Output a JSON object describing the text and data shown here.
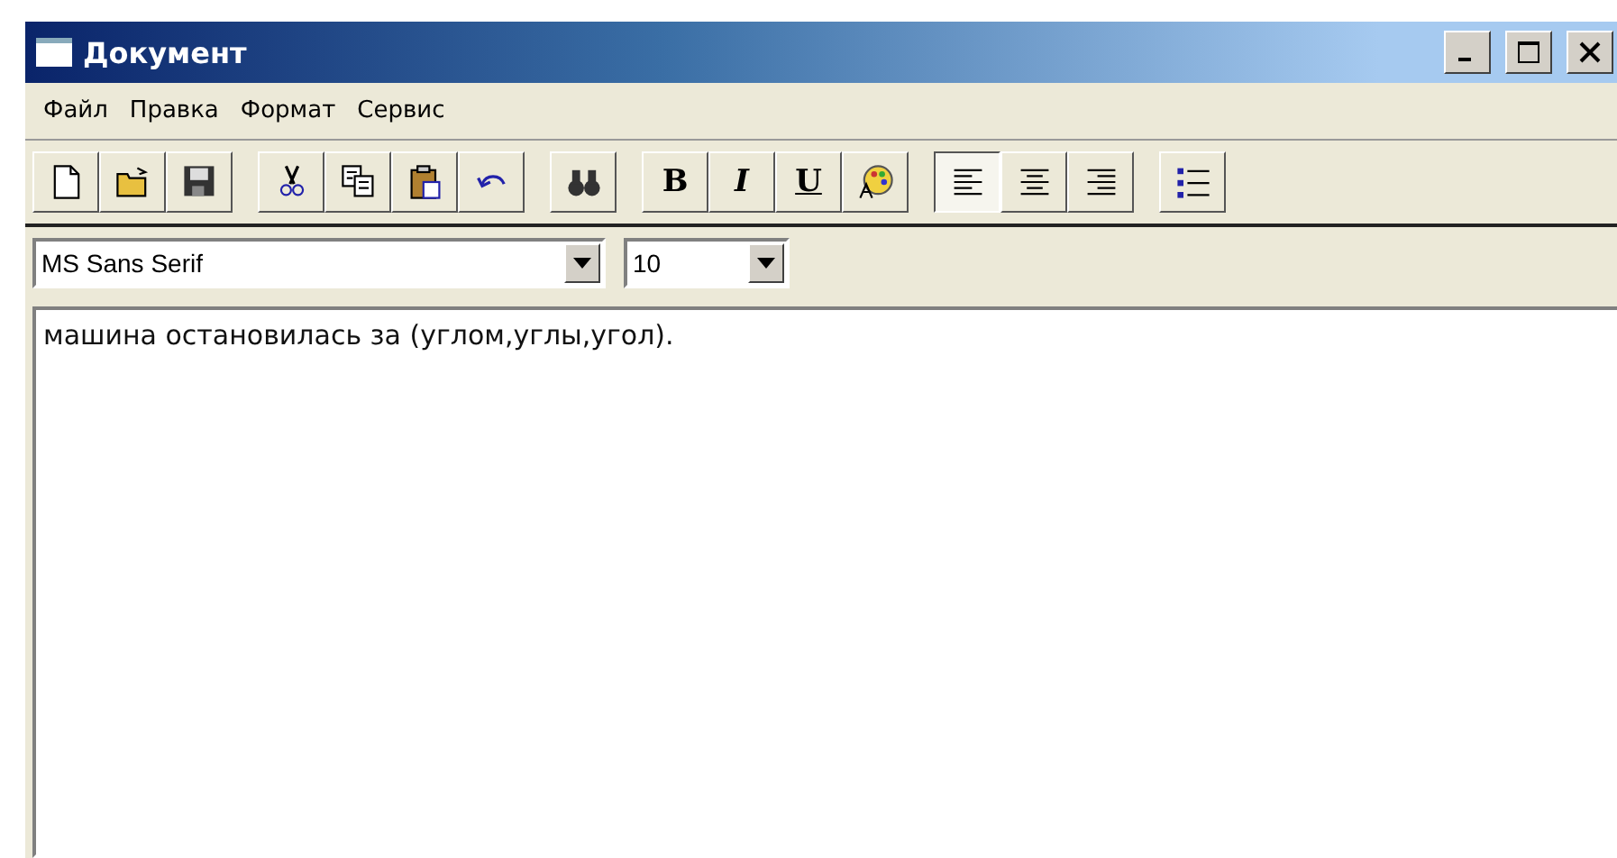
{
  "window": {
    "title": "Документ"
  },
  "menu": [
    {
      "label": "Файл"
    },
    {
      "label": "Правка"
    },
    {
      "label": "Формат"
    },
    {
      "label": "Сервис"
    }
  ],
  "toolbar": [
    {
      "kind": "new",
      "pressed": false
    },
    {
      "kind": "open",
      "pressed": false
    },
    {
      "kind": "save",
      "pressed": false
    },
    {
      "kind": "sep"
    },
    {
      "kind": "cut",
      "pressed": false
    },
    {
      "kind": "copy",
      "pressed": false
    },
    {
      "kind": "paste",
      "pressed": false
    },
    {
      "kind": "undo",
      "pressed": false
    },
    {
      "kind": "sep"
    },
    {
      "kind": "find",
      "pressed": false
    },
    {
      "kind": "sep"
    },
    {
      "kind": "bold",
      "label": "B",
      "pressed": false
    },
    {
      "kind": "italic",
      "label": "I",
      "pressed": false
    },
    {
      "kind": "underline",
      "label": "U",
      "pressed": false
    },
    {
      "kind": "color",
      "pressed": false
    },
    {
      "kind": "sep"
    },
    {
      "kind": "left",
      "pressed": true
    },
    {
      "kind": "center",
      "pressed": false
    },
    {
      "kind": "right",
      "pressed": false
    },
    {
      "kind": "sep"
    },
    {
      "kind": "bullets",
      "pressed": false
    }
  ],
  "font": {
    "name": "MS Sans Serif",
    "size": "10"
  },
  "document": {
    "text": "машина остановилась за (углом,углы,угол)."
  }
}
